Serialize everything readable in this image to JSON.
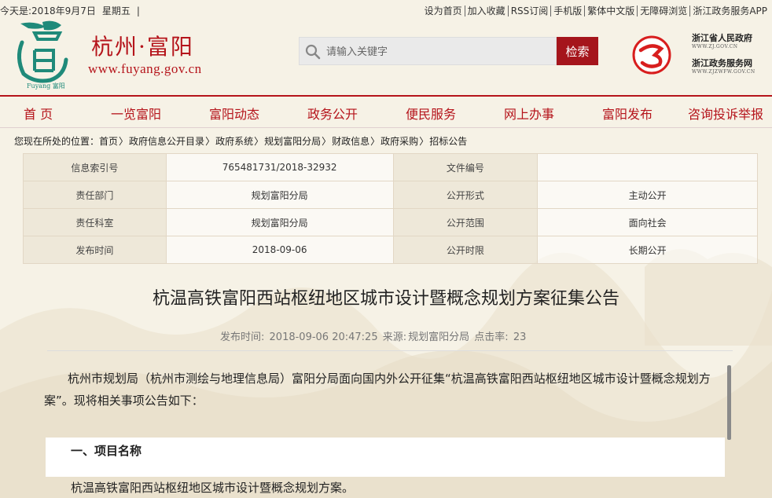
{
  "topbar": {
    "date_text": "今天是:2018年9月7日",
    "weekday": "星期五",
    "links": [
      "设为首页",
      "加入收藏",
      "RSS订阅",
      "手机版",
      "繁体中文版",
      "无障碍浏览",
      "浙江政务服务APP"
    ]
  },
  "header": {
    "logo_caption": "Fuyang 富阳",
    "title": "杭州·富阳",
    "url": "www.fuyang.gov.cn",
    "search_placeholder": "请输入关键字",
    "search_button": "检索",
    "gov_links": [
      {
        "name": "浙江省人民政府",
        "sub": "WWW.ZJ.GOV.CN"
      },
      {
        "name": "浙江政务服务网",
        "sub": "WWW.ZJZWFW.GOV.CN"
      }
    ]
  },
  "nav": [
    "首 页",
    "一览富阳",
    "富阳动态",
    "政务公开",
    "便民服务",
    "网上办事",
    "富阳发布",
    "咨询投诉举报"
  ],
  "breadcrumb": {
    "prefix": "您现在所处的位置：",
    "items": [
      "首页",
      "政府信息公开目录",
      "政府系统",
      "规划富阳分局",
      "财政信息",
      "政府采购",
      "招标公告"
    ]
  },
  "info_table": [
    [
      "信息索引号",
      "765481731/2018-32932",
      "文件编号",
      ""
    ],
    [
      "责任部门",
      "规划富阳分局",
      "公开形式",
      "主动公开"
    ],
    [
      "责任科室",
      "规划富阳分局",
      "公开范围",
      "面向社会"
    ],
    [
      "发布时间",
      "2018-09-06",
      "公开时限",
      "长期公开"
    ]
  ],
  "article": {
    "title": "杭温高铁富阳西站枢纽地区城市设计暨概念规划方案征集公告",
    "meta": {
      "time_label": "发布时间:",
      "time": "2018-09-06 20:47:25",
      "source_label": "来源:",
      "source": "规划富阳分局",
      "hits_label": "点击率:",
      "hits": "23"
    },
    "intro": "杭州市规划局（杭州市测绘与地理信息局）富阳分局面向国内外公开征集“杭温高铁富阳西站枢纽地区城市设计暨概念规划方案”。现将相关事项公告如下：",
    "section_heading": "一、项目名称",
    "section_body": "杭温高铁富阳西站枢纽地区城市设计暨概念规划方案。"
  },
  "colors": {
    "brand": "#b5141b",
    "button": "#a5151c",
    "background": "#f6f2e6"
  }
}
